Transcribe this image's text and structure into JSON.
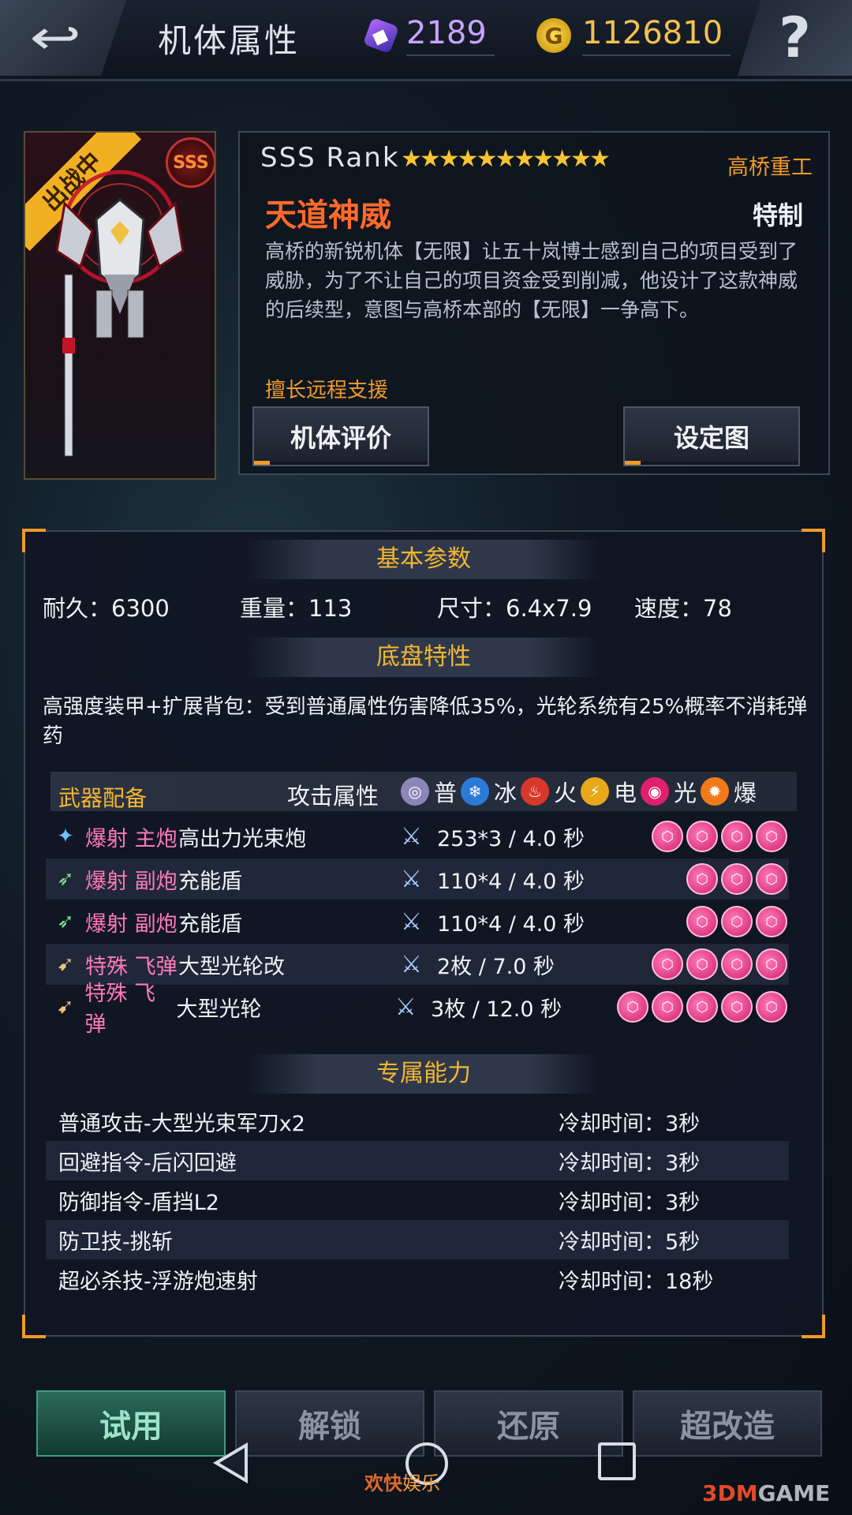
{
  "header": {
    "title": "机体属性",
    "diamonds": "2189",
    "gold": "1126810",
    "back_icon": "back-arrow-icon",
    "help_label": "?"
  },
  "mech": {
    "status_ribbon": "出战中",
    "grade_badge": "SSS",
    "rank_label": "SSS Rank",
    "stars": "★★★★★★★★★★★",
    "star_count": 11,
    "manufacturer": "高桥重工",
    "name": "天道神威",
    "type": "特制",
    "description": "高桥的新锐机体【无限】让五十岚博士感到自己的项目受到了威胁，为了不让自己的项目资金受到削减，他设计了这款神威的后续型，意图与高桥本部的【无限】一争高下。",
    "specialty": "擅长远程支援",
    "locked": true
  },
  "buttons": {
    "evaluate": "机体评价",
    "artwork": "设定图"
  },
  "basic": {
    "header": "基本参数",
    "durability": "耐久：6300",
    "weight": "重量：113",
    "size": "尺寸：6.4x7.9",
    "speed": "速度：78"
  },
  "chassis": {
    "header": "底盘特性",
    "text": "高强度装甲+扩展背包：受到普通属性伤害降低35%，光轮系统有25%概率不消耗弹药"
  },
  "weapons": {
    "header": "武器配备",
    "attack_attr_label": "攻击属性",
    "elements": [
      {
        "label": "普",
        "color": "#8a86b8"
      },
      {
        "label": "冰",
        "color": "#2a7ad8"
      },
      {
        "label": "火",
        "color": "#d8382a"
      },
      {
        "label": "电",
        "color": "#e8a81a"
      },
      {
        "label": "光",
        "color": "#e0206e"
      },
      {
        "label": "爆",
        "color": "#f07a1a"
      }
    ],
    "rows": [
      {
        "cat": "爆射 主炮",
        "name": "高出力光束炮",
        "dmg": "253*3 / 4.0 秒",
        "gems": 4,
        "icon": "beam-cannon-icon"
      },
      {
        "cat": "爆射 副炮",
        "name": "充能盾",
        "dmg": "110*4 / 4.0 秒",
        "gems": 3,
        "icon": "sub-cannon-icon"
      },
      {
        "cat": "爆射 副炮",
        "name": "充能盾",
        "dmg": "110*4 / 4.0 秒",
        "gems": 3,
        "icon": "sub-cannon-icon"
      },
      {
        "cat": "特殊 飞弹",
        "name": "大型光轮改",
        "dmg": "2枚 / 7.0 秒",
        "gems": 4,
        "icon": "missile-icon"
      },
      {
        "cat": "特殊 飞弹",
        "name": "大型光轮",
        "dmg": "3枚 / 12.0 秒",
        "gems": 5,
        "icon": "missile-icon"
      }
    ]
  },
  "abilities": {
    "header": "专属能力",
    "rows": [
      {
        "name": "普通攻击-大型光束军刀x2",
        "cd": "冷却时间：3秒"
      },
      {
        "name": "回避指令-后闪回避",
        "cd": "冷却时间：3秒"
      },
      {
        "name": "防御指令-盾挡L2",
        "cd": "冷却时间：3秒"
      },
      {
        "name": "防卫技-挑斩",
        "cd": "冷却时间：5秒"
      },
      {
        "name": "超必杀技-浮游炮速射",
        "cd": "冷却时间：18秒"
      }
    ]
  },
  "bottom_buttons": {
    "trial": "试用",
    "unlock": "解锁",
    "restore": "还原",
    "super_mod": "超改造"
  },
  "watermarks": {
    "left_a": "欢快",
    "left_b": "娱乐",
    "right_a": "3DM",
    "right_b": "GAME"
  },
  "colors": {
    "accent_orange": "#f09a2a",
    "gold_text": "#f4b630",
    "name_orange": "#ff6a2a",
    "weapon_pink": "#ff79b8"
  }
}
